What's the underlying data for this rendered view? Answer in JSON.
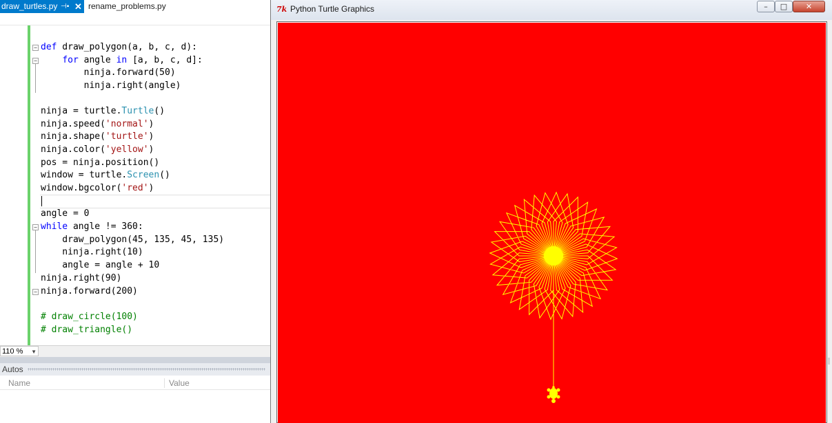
{
  "tabs": {
    "active": "draw_turtles.py",
    "pin_icon": "pin-icon",
    "close_icon": "close-icon",
    "inactive": "rename_problems.py"
  },
  "code": {
    "lines": [
      {
        "kw": "def",
        "rest": " draw_polygon(a, b, c, d):"
      },
      {
        "indent": "    ",
        "kw": "for",
        "mid": " angle ",
        "kw2": "in",
        "rest": " [a, b, c, d]:"
      },
      {
        "text": "        ninja.forward(50)"
      },
      {
        "text": "        ninja.right(angle)"
      },
      {
        "pre": "ninja = turtle.",
        "cls": "Turtle",
        "post": "()"
      },
      {
        "pre": "ninja.speed(",
        "str": "'normal'",
        "post": ")"
      },
      {
        "pre": "ninja.shape(",
        "str": "'turtle'",
        "post": ")"
      },
      {
        "pre": "ninja.color(",
        "str": "'yellow'",
        "post": ")"
      },
      {
        "text": "pos = ninja.position()"
      },
      {
        "pre": "window = turtle.",
        "cls": "Screen",
        "post": "()"
      },
      {
        "pre": "window.bgcolor(",
        "str": "'red'",
        "post": ")"
      },
      {
        "text": "angle = 0"
      },
      {
        "kw": "while",
        "rest": " angle != 360:"
      },
      {
        "text": "    draw_polygon(45, 135, 45, 135)"
      },
      {
        "text": "    ninja.right(10)"
      },
      {
        "text": "    angle = angle + 10"
      },
      {
        "text": "ninja.right(90)"
      },
      {
        "text": "ninja.forward(200)"
      },
      {
        "comment": "# draw_circle(100)"
      },
      {
        "comment": "# draw_triangle()"
      }
    ]
  },
  "zoom": "110 %",
  "autos": {
    "title": "Autos",
    "col_name": "Name",
    "col_value": "Value"
  },
  "turtle_window": {
    "icon": "tk-icon",
    "icon_text": "7k",
    "title": "Python Turtle Graphics",
    "min_symbol": "–",
    "max_symbol": "□",
    "close_symbol": "✕",
    "bgcolor": "#ff0000",
    "pen_color": "#ffff00",
    "drawing": {
      "polygon_step": 50,
      "polygon_angles": [
        45,
        135,
        45,
        135
      ],
      "rotation_step_deg": 10,
      "repeat_count": 36,
      "final_right_deg": 90,
      "final_forward": 200
    }
  }
}
